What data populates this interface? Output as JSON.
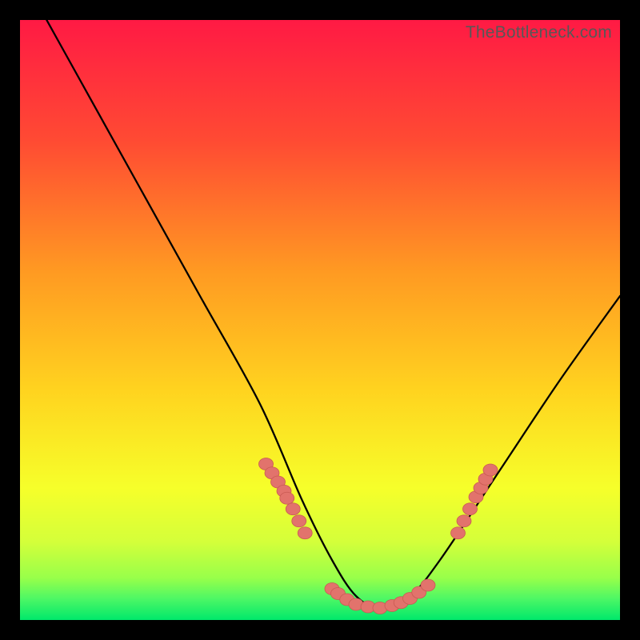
{
  "watermark": "TheBottleneck.com",
  "colors": {
    "background": "#000000",
    "gradient_top": "#ff1a44",
    "gradient_upper_mid": "#ff6a2a",
    "gradient_mid": "#ffcc22",
    "gradient_lower_mid": "#f6ff2a",
    "gradient_low": "#d4ff3a",
    "gradient_bottom": "#00e86b",
    "curve": "#000000",
    "marker": "#e2736c",
    "marker_stroke": "#c95a53"
  },
  "chart_data": {
    "type": "line",
    "title": "",
    "xlabel": "",
    "ylabel": "",
    "xlim": [
      0,
      100
    ],
    "ylim": [
      0,
      100
    ],
    "grid": false,
    "legend": false,
    "annotations": [],
    "series": [
      {
        "name": "bottleneck-curve",
        "x": [
          0,
          10,
          20,
          30,
          40,
          47,
          52,
          56,
          60,
          65,
          70,
          80,
          90,
          100
        ],
        "y": [
          108,
          90,
          72,
          54,
          36,
          20,
          10,
          4,
          2,
          4,
          10,
          25,
          40,
          54
        ]
      }
    ],
    "markers": [
      {
        "name": "left-cluster",
        "points": [
          {
            "x": 41,
            "y": 26
          },
          {
            "x": 42,
            "y": 24.5
          },
          {
            "x": 43,
            "y": 23
          },
          {
            "x": 44,
            "y": 21.5
          },
          {
            "x": 44.5,
            "y": 20.3
          },
          {
            "x": 45.5,
            "y": 18.5
          },
          {
            "x": 46.5,
            "y": 16.5
          },
          {
            "x": 47.5,
            "y": 14.5
          }
        ]
      },
      {
        "name": "bottom-cluster",
        "points": [
          {
            "x": 52,
            "y": 5.2
          },
          {
            "x": 53,
            "y": 4.4
          },
          {
            "x": 54.5,
            "y": 3.4
          },
          {
            "x": 56,
            "y": 2.6
          },
          {
            "x": 58,
            "y": 2.2
          },
          {
            "x": 60,
            "y": 2.0
          },
          {
            "x": 62,
            "y": 2.4
          },
          {
            "x": 63.5,
            "y": 2.9
          },
          {
            "x": 65,
            "y": 3.6
          },
          {
            "x": 66.5,
            "y": 4.6
          },
          {
            "x": 68,
            "y": 5.8
          }
        ]
      },
      {
        "name": "right-cluster",
        "points": [
          {
            "x": 73,
            "y": 14.5
          },
          {
            "x": 74,
            "y": 16.5
          },
          {
            "x": 75,
            "y": 18.5
          },
          {
            "x": 76,
            "y": 20.5
          },
          {
            "x": 76.8,
            "y": 22
          },
          {
            "x": 77.6,
            "y": 23.5
          },
          {
            "x": 78.4,
            "y": 25
          }
        ]
      }
    ]
  }
}
